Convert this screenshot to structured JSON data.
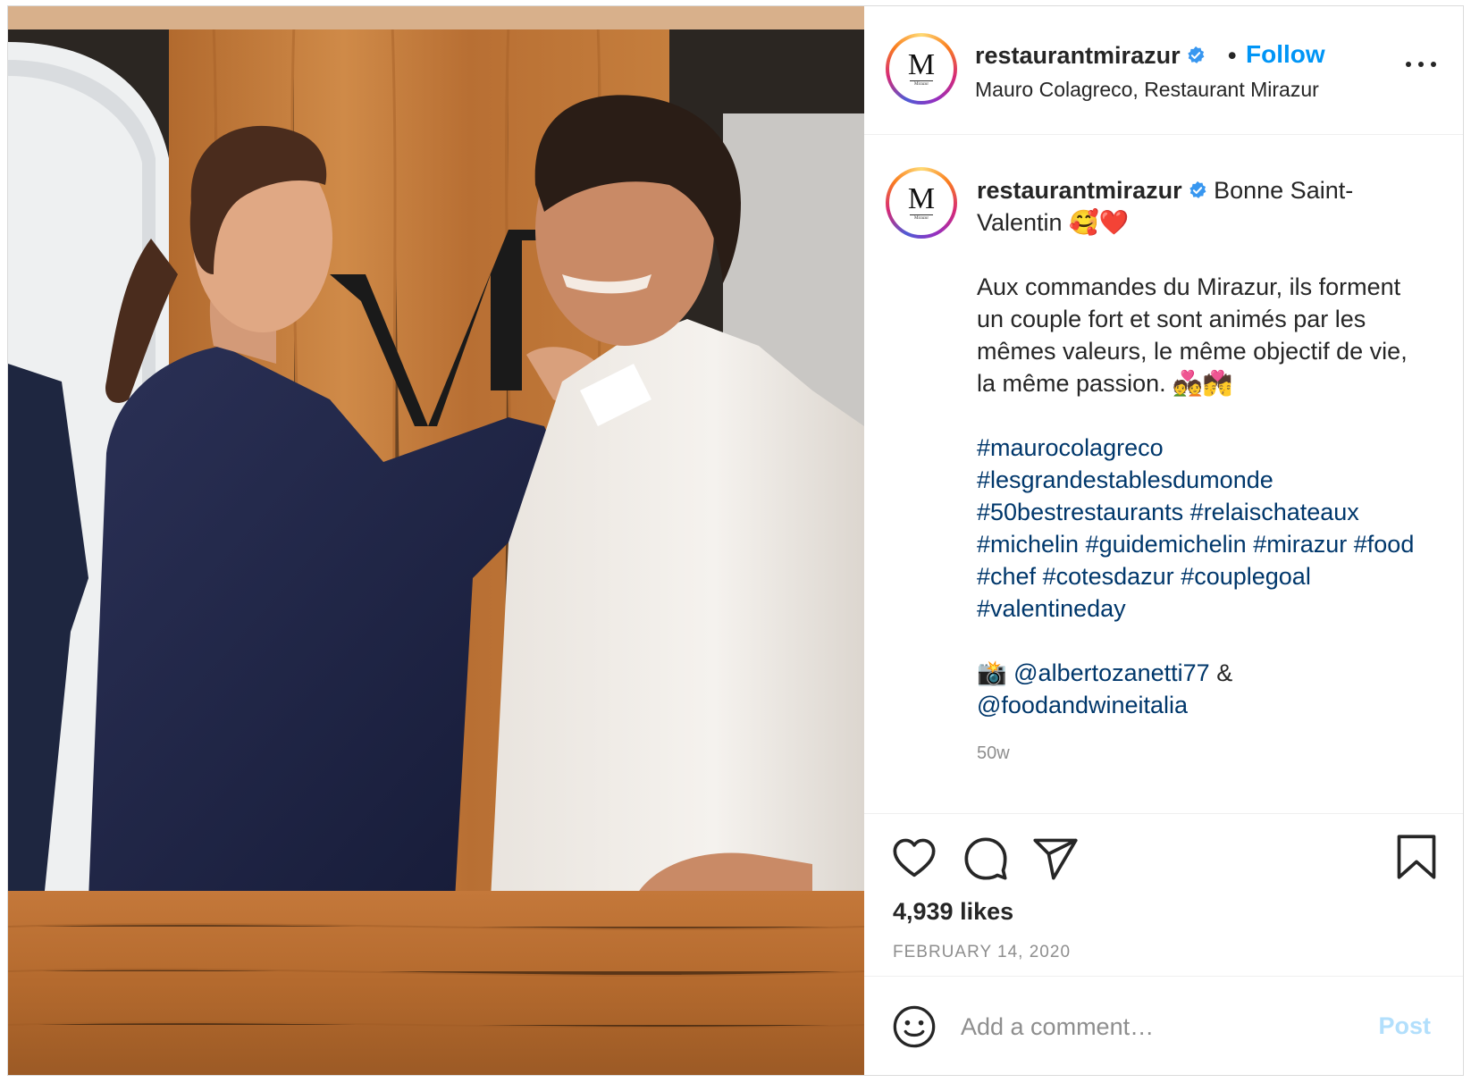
{
  "post": {
    "photo_alt": "",
    "avatar_logo": "M",
    "avatar_logo_small": "Mirazur"
  },
  "header": {
    "username": "restaurantmirazur",
    "separator": "•",
    "follow_label": "Follow",
    "location": "Mauro Colagreco, Restaurant Mirazur",
    "more_icon": "more-options-icon"
  },
  "caption": {
    "username": "restaurantmirazur",
    "title_text": "Bonne Saint-Valentin 🥰❤️",
    "body": "Aux commandes du Mirazur, ils forment un couple fort et sont animés par les mêmes valeurs, le même objectif de vie, la même passion. 💑💏",
    "hashtags": [
      "#maurocolagreco",
      "#lesgrandestablesdumonde",
      "#50bestrestaurants",
      "#relaischateaux",
      "#michelin",
      "#guidemichelin",
      "#mirazur",
      "#food",
      "#chef",
      "#cotesdazur",
      "#couplegoal",
      "#valentineday"
    ],
    "credit_emoji": "📸",
    "credit_user1": "@albertozanetti77",
    "credit_join": "&",
    "credit_user2": "@foodandwineitalia",
    "time_ago": "50w"
  },
  "actions": {
    "like_icon": "heart-icon",
    "comment_icon": "comment-icon",
    "share_icon": "paper-plane-icon",
    "save_icon": "bookmark-icon",
    "likes": "4,939 likes",
    "date": "FEBRUARY 14, 2020"
  },
  "comment_box": {
    "emoji_icon": "smiley-icon",
    "placeholder": "Add a comment…",
    "post_label": "Post",
    "post_color": "#b2dffc"
  },
  "colors": {
    "accent": "#0095f6",
    "hashtag": "#00376b",
    "verified": "#3897f0",
    "muted": "#8e8e8e"
  }
}
